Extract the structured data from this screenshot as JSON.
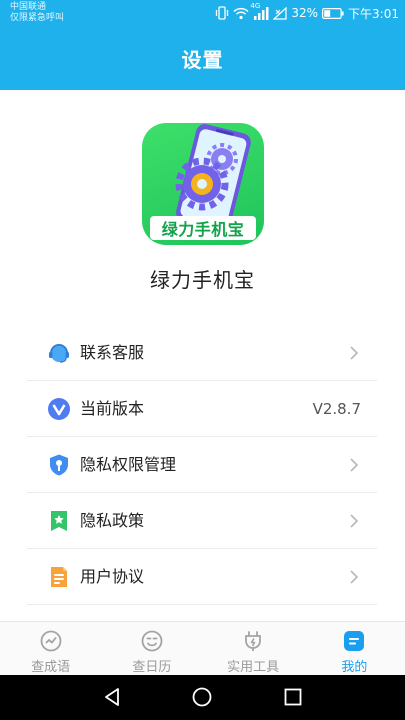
{
  "status_bar": {
    "carrier_line1": "中国联通",
    "carrier_line2": "仅限紧急呼叫",
    "battery": "32%",
    "time": "下午3:01",
    "network": "4G"
  },
  "header": {
    "title": "设置"
  },
  "app": {
    "name": "绿力手机宝",
    "logo_text": "绿力手机宝"
  },
  "menu": {
    "items": [
      {
        "label": "联系客服",
        "icon": "customer-service-icon"
      },
      {
        "label": "当前版本",
        "icon": "version-icon",
        "value": "V2.8.7"
      },
      {
        "label": "隐私权限管理",
        "icon": "privacy-permission-icon"
      },
      {
        "label": "隐私政策",
        "icon": "privacy-policy-icon"
      },
      {
        "label": "用户协议",
        "icon": "user-agreement-icon"
      }
    ]
  },
  "tabs": [
    {
      "label": "查成语",
      "icon": "idiom-icon",
      "active": false
    },
    {
      "label": "查日历",
      "icon": "calendar-face-icon",
      "active": false
    },
    {
      "label": "实用工具",
      "icon": "plug-tool-icon",
      "active": false
    },
    {
      "label": "我的",
      "icon": "profile-icon",
      "active": true
    }
  ],
  "colors": {
    "primary": "#1fb1ec",
    "tab_active": "#1a9ff0",
    "tab_inactive": "#9a9a9a",
    "logo_green": "#1fc35a"
  }
}
